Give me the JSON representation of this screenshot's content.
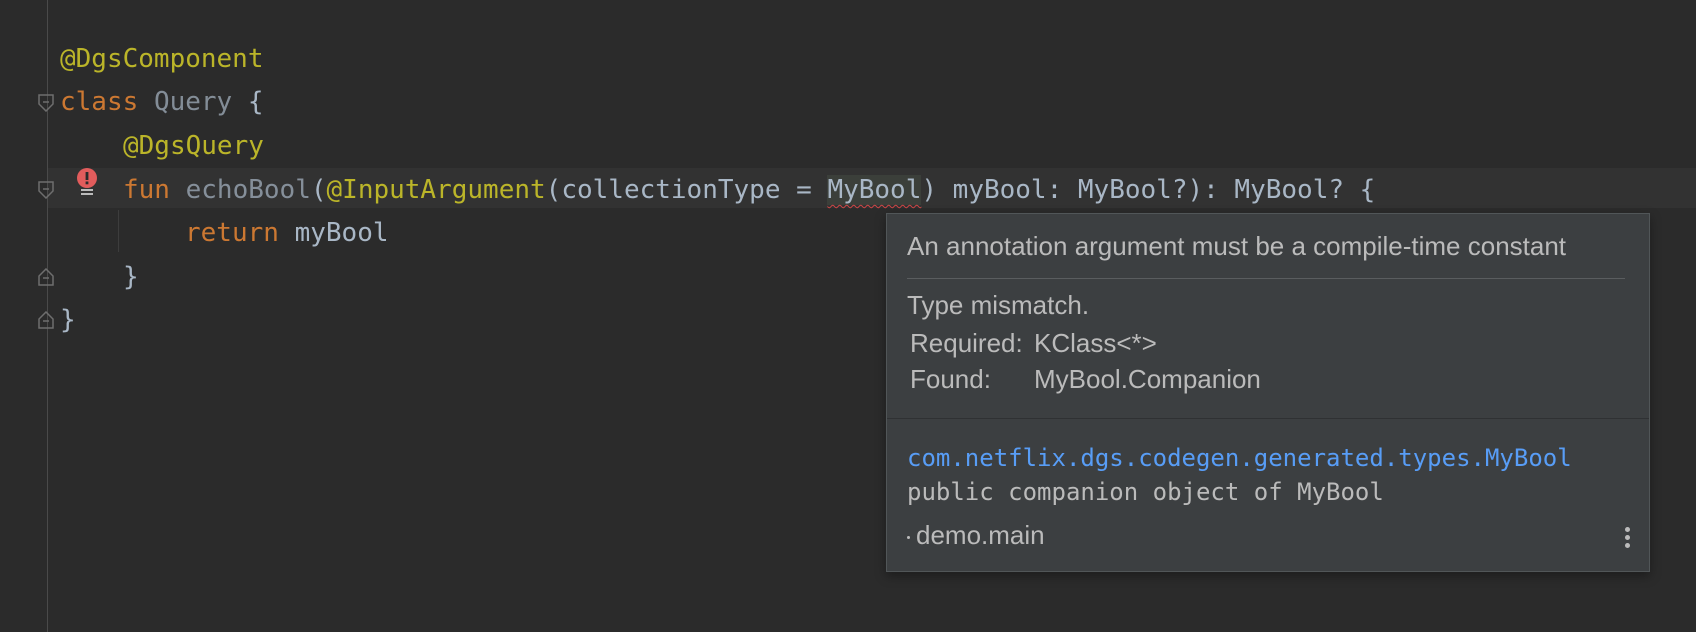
{
  "editor": {
    "lines": {
      "l1_annotation": "@DgsComponent",
      "l2_keyword": "class",
      "l2_name": "Query",
      "l2_brace": "{",
      "l3_annotation": "@DgsQuery",
      "l4_keyword": "fun",
      "l4_name": "echoBool",
      "l4_open": "(",
      "l4_annotation": "@InputArgument",
      "l4_arg_open": "(collectionType = ",
      "l4_error_token": "MyBool",
      "l4_rest": ") myBool: MyBool?): MyBool? {",
      "l5_keyword": "return",
      "l5_ident": "myBool",
      "l6_brace": "}",
      "l7_brace": "}"
    },
    "colors": {
      "background": "#2b2b2b",
      "annotation": "#bbb529",
      "keyword": "#cc7832",
      "identifier": "#a9b7c6",
      "error": "#d04646"
    }
  },
  "error_popup": {
    "header": "An annotation argument must be a compile-time constant",
    "message": "Type mismatch.",
    "required_label": "Required:",
    "required_value": "KClass<*>",
    "found_label": "Found:",
    "found_value": "MyBool.Companion",
    "fq_name": "com.netflix.dgs.codegen.generated.types.MyBool",
    "declaration": "public companion object of MyBool",
    "module": "demo.main",
    "more_icon": "more-vertical-icon",
    "link_color": "#589df6"
  }
}
